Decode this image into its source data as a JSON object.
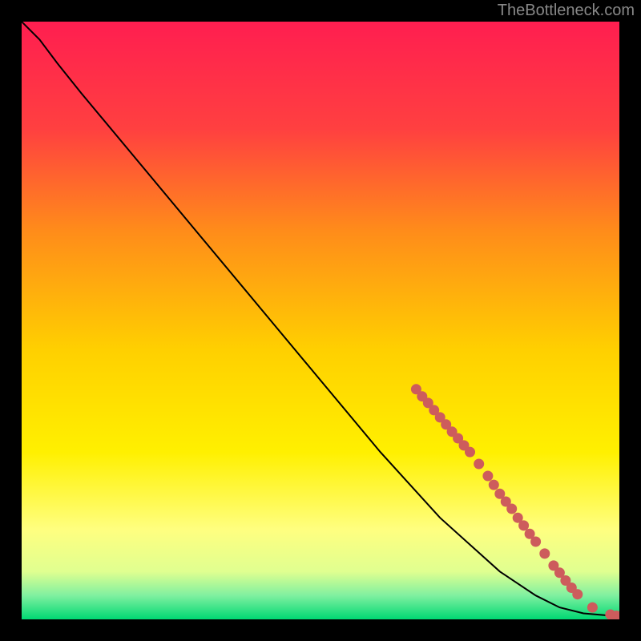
{
  "watermark": "TheBottleneck.com",
  "chart_data": {
    "type": "line",
    "title": "",
    "xlabel": "",
    "ylabel": "",
    "xlim": [
      0,
      100
    ],
    "ylim": [
      0,
      100
    ],
    "background_gradient": {
      "top": "#FF1E50",
      "mid1": "#FF7A2A",
      "mid2": "#FFD700",
      "mid3": "#FFFF66",
      "bottom": "#00E673"
    },
    "curve": [
      {
        "x": 0,
        "y": 100
      },
      {
        "x": 3,
        "y": 97
      },
      {
        "x": 6,
        "y": 93
      },
      {
        "x": 10,
        "y": 88
      },
      {
        "x": 20,
        "y": 76
      },
      {
        "x": 30,
        "y": 64
      },
      {
        "x": 40,
        "y": 52
      },
      {
        "x": 50,
        "y": 40
      },
      {
        "x": 60,
        "y": 28
      },
      {
        "x": 70,
        "y": 17
      },
      {
        "x": 80,
        "y": 8
      },
      {
        "x": 86,
        "y": 4
      },
      {
        "x": 90,
        "y": 2
      },
      {
        "x": 94,
        "y": 1
      },
      {
        "x": 100,
        "y": 0.5
      }
    ],
    "highlight_points": [
      {
        "x": 66,
        "y": 38.5
      },
      {
        "x": 67,
        "y": 37.3
      },
      {
        "x": 68,
        "y": 36.2
      },
      {
        "x": 69,
        "y": 35.0
      },
      {
        "x": 70,
        "y": 33.8
      },
      {
        "x": 71,
        "y": 32.6
      },
      {
        "x": 72,
        "y": 31.4
      },
      {
        "x": 73,
        "y": 30.3
      },
      {
        "x": 74,
        "y": 29.1
      },
      {
        "x": 75,
        "y": 28.0
      },
      {
        "x": 76.5,
        "y": 26.0
      },
      {
        "x": 78,
        "y": 24.0
      },
      {
        "x": 79,
        "y": 22.5
      },
      {
        "x": 80,
        "y": 21.0
      },
      {
        "x": 81,
        "y": 19.7
      },
      {
        "x": 82,
        "y": 18.5
      },
      {
        "x": 83,
        "y": 17.0
      },
      {
        "x": 84,
        "y": 15.7
      },
      {
        "x": 85,
        "y": 14.3
      },
      {
        "x": 86,
        "y": 13.0
      },
      {
        "x": 87.5,
        "y": 11.0
      },
      {
        "x": 89,
        "y": 9.0
      },
      {
        "x": 90,
        "y": 7.8
      },
      {
        "x": 91,
        "y": 6.5
      },
      {
        "x": 92,
        "y": 5.3
      },
      {
        "x": 93,
        "y": 4.2
      },
      {
        "x": 95.5,
        "y": 2.0
      },
      {
        "x": 98.5,
        "y": 0.8
      },
      {
        "x": 99.5,
        "y": 0.6
      }
    ],
    "point_color": "#CD5C5C",
    "line_color": "#000000"
  }
}
